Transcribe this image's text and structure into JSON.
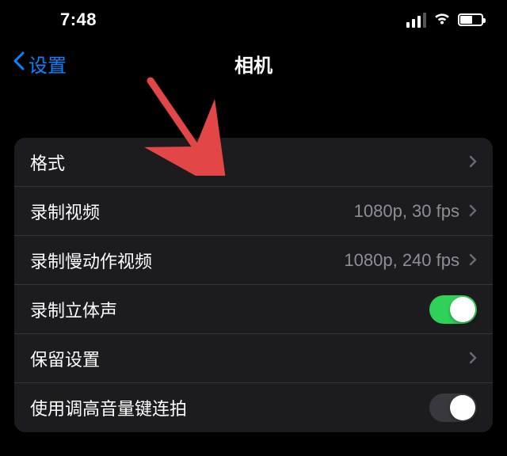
{
  "status": {
    "time": "7:48"
  },
  "nav": {
    "back_label": "设置",
    "title": "相机"
  },
  "rows": {
    "format": {
      "label": "格式"
    },
    "record_video": {
      "label": "录制视频",
      "value": "1080p, 30 fps"
    },
    "record_slomo": {
      "label": "录制慢动作视频",
      "value": "1080p, 240 fps"
    },
    "stereo": {
      "label": "录制立体声",
      "on": true
    },
    "preserve": {
      "label": "保留设置"
    },
    "volume_burst": {
      "label": "使用调高音量键连拍",
      "on": false
    }
  },
  "annotation": {
    "arrow_color": "#e24646"
  }
}
